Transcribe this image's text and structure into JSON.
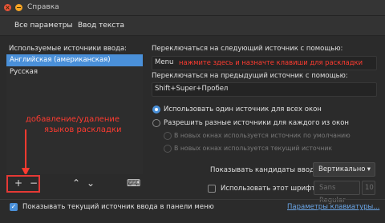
{
  "window": {
    "title": "Справка",
    "close_glyph": "×",
    "minimize_glyph": "−"
  },
  "tabs": [
    {
      "label": "Все параметры"
    },
    {
      "label": "Ввод текста"
    }
  ],
  "sources": {
    "heading": "Используемые источники ввода:",
    "items": [
      {
        "label": "Английская (американская)"
      },
      {
        "label": "Русская"
      }
    ],
    "add_glyph": "+",
    "remove_glyph": "−",
    "up_glyph": "⌃",
    "down_glyph": "⌄",
    "keyboard_glyph": "⌨"
  },
  "annotation_left": [
    "добавление/удаление",
    "языков раскладки"
  ],
  "annotation_right": "нажмите здесь и назначте клавиши для раскладки",
  "next_source": {
    "label": "Переключаться на следующий источник с помощью:",
    "value": "Menu"
  },
  "prev_source": {
    "label": "Переключаться на предыдущий источник с помощью:",
    "value": "Shift+Super+Пробел"
  },
  "mode": {
    "one_for_all": "Использовать один источник для всех окон",
    "per_window": "Разрешить разные источники для каждого из окон",
    "default_src": "В новых окнах используется источник по умолчанию",
    "current_src": "В новых окнах используется текущий источник"
  },
  "candidates": {
    "label": "Показывать кандидаты ввода:",
    "value": "Вертикально",
    "arrow": "▾"
  },
  "font": {
    "label": "Использовать этот шрифт:",
    "family": "Sans Regular",
    "size": "10"
  },
  "show_source": {
    "label": "Показывать текущий источник ввода в панели меню",
    "check_glyph": "✓"
  },
  "keyboard_link": "Параметры клавиатуры..."
}
